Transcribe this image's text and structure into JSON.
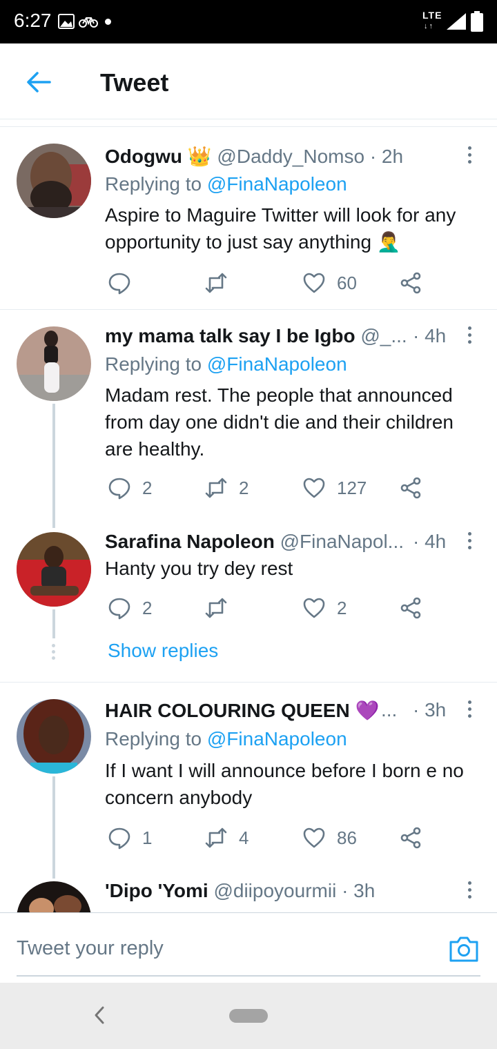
{
  "status_bar": {
    "time": "6:27",
    "network": "LTE",
    "network_arrows": "↓↑"
  },
  "header": {
    "title": "Tweet"
  },
  "tweets": [
    {
      "name": "Odogwu",
      "name_emoji": "👑",
      "handle": "@Daddy_Nomso",
      "time": "· 2h",
      "replying_prefix": "Replying to",
      "replying_to": "@FinaNapoleon",
      "text": "Aspire to Maguire Twitter will look for any opportunity to just say anything 🤦‍♂️",
      "replies": "",
      "retweets": "",
      "likes": "60"
    },
    {
      "name": "my mama talk say I be Igbo",
      "name_emoji": "",
      "handle": "@_...",
      "time": "· 4h",
      "replying_prefix": "Replying to",
      "replying_to": "@FinaNapoleon",
      "text": "Madam rest. The people that announced from day one didn't die and their children are healthy.",
      "replies": "2",
      "retweets": "2",
      "likes": "127"
    },
    {
      "name": "Sarafina Napoleon",
      "name_emoji": "",
      "handle": "@FinaNapol...",
      "time": "· 4h",
      "replying_prefix": "",
      "replying_to": "",
      "text": "Hanty you try dey rest",
      "replies": "2",
      "retweets": "",
      "likes": "2"
    },
    {
      "name": "HAIR COLOURING QUEEN",
      "name_emoji": "💜",
      "handle": "...",
      "time": "· 3h",
      "replying_prefix": "Replying to",
      "replying_to": "@FinaNapoleon",
      "text": "If I want I will announce before I born e no concern anybody",
      "replies": "1",
      "retweets": "4",
      "likes": "86"
    },
    {
      "name": "'Dipo 'Yomi",
      "name_emoji": "",
      "handle": "@diipoyourmii",
      "time": "· 3h",
      "replying_prefix": "",
      "replying_to": "",
      "text": "",
      "replies": "",
      "retweets": "",
      "likes": ""
    }
  ],
  "show_replies_label": "Show replies",
  "reply_bar": {
    "placeholder": "Tweet your reply"
  },
  "colors": {
    "accent": "#1da1f2",
    "secondary_text": "#657786",
    "divider": "#e6ecf0",
    "thread_line": "#ccd6dd"
  },
  "icons": [
    "back-arrow-icon",
    "reply-icon",
    "retweet-icon",
    "like-icon",
    "share-icon",
    "more-icon",
    "camera-icon",
    "nav-back-icon"
  ]
}
